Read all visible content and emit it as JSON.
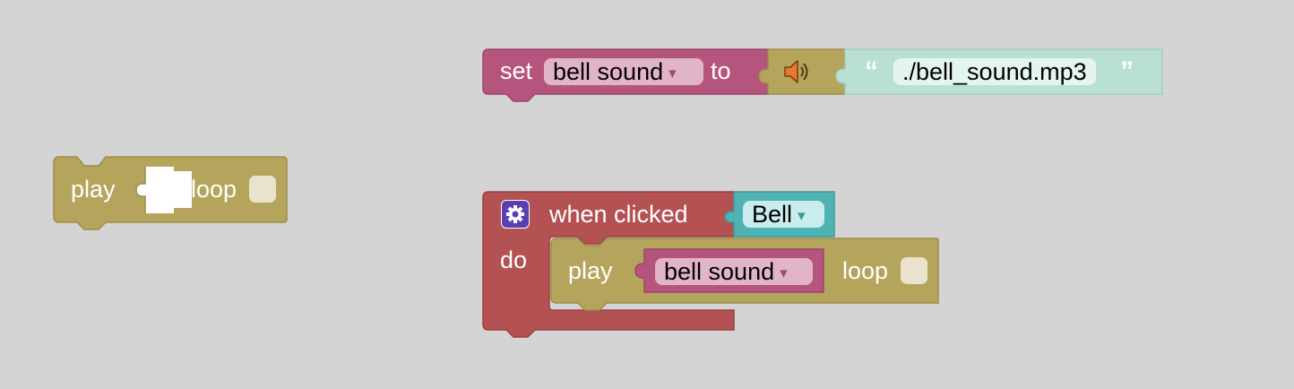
{
  "colors": {
    "sound": "#b5a55c",
    "sound_dark": "#9c8d4a",
    "variable": "#b5557d",
    "variable_field": "#e2b4c8",
    "event": "#b35153",
    "event_dark": "#9a4042",
    "text": "#b9e0d2",
    "button": "#4fb3b3",
    "button_field": "#c9ecec",
    "dropdown_arrow": "#a14a73"
  },
  "blocks": {
    "play_loose": {
      "play_label": "play",
      "loop_label": "loop",
      "loop_checked": false
    },
    "set_variable": {
      "set_label": "set",
      "variable_name": "bell sound",
      "to_label": "to",
      "sound_icon": "speaker-icon",
      "open_quote": "“",
      "close_quote": "”",
      "string_value": "./bell_sound.mp3"
    },
    "when_clicked": {
      "gear_icon": "gear-icon",
      "label": "when clicked",
      "button_name": "Bell",
      "do_label": "do",
      "play": {
        "play_label": "play",
        "variable_name": "bell sound",
        "loop_label": "loop",
        "loop_checked": false
      }
    }
  },
  "dropdown_arrow": "▾"
}
